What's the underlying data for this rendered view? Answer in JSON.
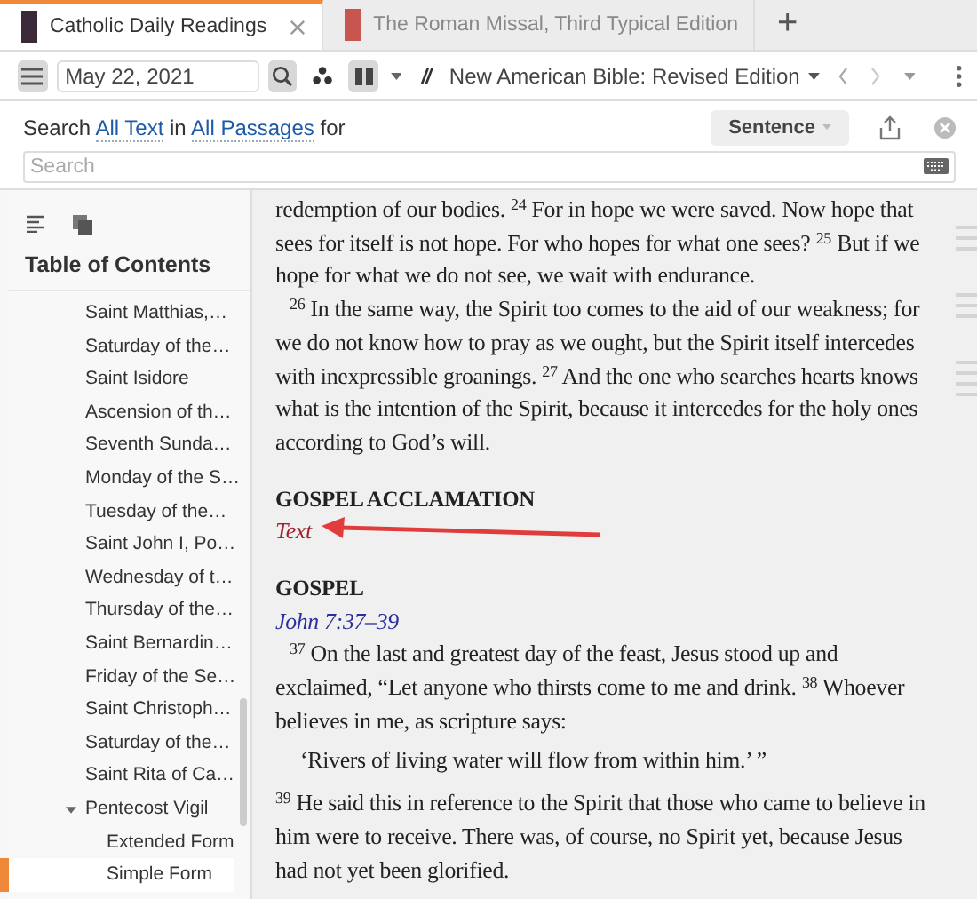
{
  "tabs": [
    {
      "label": "Catholic Daily Readings",
      "selected": true
    },
    {
      "label": "The Roman Missal, Third Typical Edition",
      "selected": false
    }
  ],
  "new_tab": "+",
  "toolbar": {
    "date": "May 22, 2021",
    "parallel": "//",
    "version": "New American Bible: Revised Edition"
  },
  "search": {
    "prompt": [
      {
        "kind": "text",
        "text": "Search"
      },
      {
        "kind": "link",
        "text": "All Text"
      },
      {
        "kind": "text",
        "text": "in"
      },
      {
        "kind": "link",
        "text": "All Passages"
      },
      {
        "kind": "text",
        "text": "for"
      }
    ],
    "mode": "Sentence",
    "placeholder": "Search"
  },
  "sidebar": {
    "title": "Table of Contents",
    "items": [
      {
        "label": "Saint Matthias,…",
        "selected": false
      },
      {
        "label": "Saturday of the…",
        "selected": false
      },
      {
        "label": "Saint Isidore",
        "selected": false
      },
      {
        "label": "Ascension of th…",
        "selected": false
      },
      {
        "label": "Seventh Sunda…",
        "selected": false
      },
      {
        "label": "Monday of the S…",
        "selected": false
      },
      {
        "label": "Tuesday of the…",
        "selected": false
      },
      {
        "label": "Saint John I, Po…",
        "selected": false
      },
      {
        "label": "Wednesday of t…",
        "selected": false
      },
      {
        "label": "Thursday of the…",
        "selected": false
      },
      {
        "label": "Saint Bernardin…",
        "selected": false
      },
      {
        "label": "Friday of the Se…",
        "selected": false
      },
      {
        "label": "Saint Christoph…",
        "selected": false
      },
      {
        "label": "Saturday of the…",
        "selected": false
      },
      {
        "label": "Saint Rita of Ca…",
        "selected": false
      },
      {
        "label": "Pentecost Vigil",
        "selected": false,
        "expanded": true,
        "children": [
          {
            "label": "Extended Form",
            "selected": false
          },
          {
            "label": "Simple Form",
            "selected": true
          }
        ]
      }
    ]
  },
  "content": [
    {
      "kind": "paragraph",
      "indent": false,
      "text": "redemption of our bodies. $^{24}$ For in hope we were saved. Now hope that sees for itself is not hope. For who hopes for what one sees? $^{25}$ But if we hope for what we do not see, we wait with endurance."
    },
    {
      "kind": "paragraph",
      "indent": true,
      "text": "$^{26}$ In the same way, the Spirit too comes to the aid of our weakness; for we do not know how to pray as we ought, but the Spirit itself intercedes with inexpressible groanings. $^{27}$ And the one who searches hearts knows what is the intention of the Spirit, because it intercedes for the holy ones according to God’s will."
    },
    {
      "kind": "heading",
      "text": "GOSPEL ACCLAMATION"
    },
    {
      "kind": "note",
      "text": "Text"
    },
    {
      "kind": "heading",
      "text": "GOSPEL"
    },
    {
      "kind": "reference",
      "text": "John 7:37–39"
    },
    {
      "kind": "paragraph",
      "indent": true,
      "text": "$^{37}$ On the last and greatest day of the feast, Jesus stood up and exclaimed, “Let anyone who thirsts come to me and drink. $^{38}$ Whoever believes in me, as scripture says:"
    },
    {
      "kind": "quote",
      "text": "‘Rivers of living water will flow from within him.’ ”"
    },
    {
      "kind": "paragraph",
      "indent": false,
      "text": "$^{39}$ He said this in reference to the Spirit that those who came to believe in him were to receive. There was, of course, no Spirit yet, because Jesus had not yet been glorified."
    }
  ]
}
